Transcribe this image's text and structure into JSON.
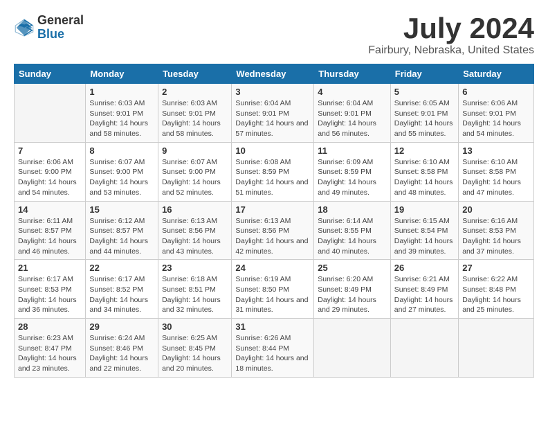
{
  "logo": {
    "general": "General",
    "blue": "Blue"
  },
  "title": "July 2024",
  "subtitle": "Fairbury, Nebraska, United States",
  "days": [
    "Sunday",
    "Monday",
    "Tuesday",
    "Wednesday",
    "Thursday",
    "Friday",
    "Saturday"
  ],
  "weeks": [
    [
      {
        "date": "",
        "sunrise": "",
        "sunset": "",
        "daylight": ""
      },
      {
        "date": "1",
        "sunrise": "Sunrise: 6:03 AM",
        "sunset": "Sunset: 9:01 PM",
        "daylight": "Daylight: 14 hours and 58 minutes."
      },
      {
        "date": "2",
        "sunrise": "Sunrise: 6:03 AM",
        "sunset": "Sunset: 9:01 PM",
        "daylight": "Daylight: 14 hours and 58 minutes."
      },
      {
        "date": "3",
        "sunrise": "Sunrise: 6:04 AM",
        "sunset": "Sunset: 9:01 PM",
        "daylight": "Daylight: 14 hours and 57 minutes."
      },
      {
        "date": "4",
        "sunrise": "Sunrise: 6:04 AM",
        "sunset": "Sunset: 9:01 PM",
        "daylight": "Daylight: 14 hours and 56 minutes."
      },
      {
        "date": "5",
        "sunrise": "Sunrise: 6:05 AM",
        "sunset": "Sunset: 9:01 PM",
        "daylight": "Daylight: 14 hours and 55 minutes."
      },
      {
        "date": "6",
        "sunrise": "Sunrise: 6:06 AM",
        "sunset": "Sunset: 9:01 PM",
        "daylight": "Daylight: 14 hours and 54 minutes."
      }
    ],
    [
      {
        "date": "7",
        "sunrise": "Sunrise: 6:06 AM",
        "sunset": "Sunset: 9:00 PM",
        "daylight": "Daylight: 14 hours and 54 minutes."
      },
      {
        "date": "8",
        "sunrise": "Sunrise: 6:07 AM",
        "sunset": "Sunset: 9:00 PM",
        "daylight": "Daylight: 14 hours and 53 minutes."
      },
      {
        "date": "9",
        "sunrise": "Sunrise: 6:07 AM",
        "sunset": "Sunset: 9:00 PM",
        "daylight": "Daylight: 14 hours and 52 minutes."
      },
      {
        "date": "10",
        "sunrise": "Sunrise: 6:08 AM",
        "sunset": "Sunset: 8:59 PM",
        "daylight": "Daylight: 14 hours and 51 minutes."
      },
      {
        "date": "11",
        "sunrise": "Sunrise: 6:09 AM",
        "sunset": "Sunset: 8:59 PM",
        "daylight": "Daylight: 14 hours and 49 minutes."
      },
      {
        "date": "12",
        "sunrise": "Sunrise: 6:10 AM",
        "sunset": "Sunset: 8:58 PM",
        "daylight": "Daylight: 14 hours and 48 minutes."
      },
      {
        "date": "13",
        "sunrise": "Sunrise: 6:10 AM",
        "sunset": "Sunset: 8:58 PM",
        "daylight": "Daylight: 14 hours and 47 minutes."
      }
    ],
    [
      {
        "date": "14",
        "sunrise": "Sunrise: 6:11 AM",
        "sunset": "Sunset: 8:57 PM",
        "daylight": "Daylight: 14 hours and 46 minutes."
      },
      {
        "date": "15",
        "sunrise": "Sunrise: 6:12 AM",
        "sunset": "Sunset: 8:57 PM",
        "daylight": "Daylight: 14 hours and 44 minutes."
      },
      {
        "date": "16",
        "sunrise": "Sunrise: 6:13 AM",
        "sunset": "Sunset: 8:56 PM",
        "daylight": "Daylight: 14 hours and 43 minutes."
      },
      {
        "date": "17",
        "sunrise": "Sunrise: 6:13 AM",
        "sunset": "Sunset: 8:56 PM",
        "daylight": "Daylight: 14 hours and 42 minutes."
      },
      {
        "date": "18",
        "sunrise": "Sunrise: 6:14 AM",
        "sunset": "Sunset: 8:55 PM",
        "daylight": "Daylight: 14 hours and 40 minutes."
      },
      {
        "date": "19",
        "sunrise": "Sunrise: 6:15 AM",
        "sunset": "Sunset: 8:54 PM",
        "daylight": "Daylight: 14 hours and 39 minutes."
      },
      {
        "date": "20",
        "sunrise": "Sunrise: 6:16 AM",
        "sunset": "Sunset: 8:53 PM",
        "daylight": "Daylight: 14 hours and 37 minutes."
      }
    ],
    [
      {
        "date": "21",
        "sunrise": "Sunrise: 6:17 AM",
        "sunset": "Sunset: 8:53 PM",
        "daylight": "Daylight: 14 hours and 36 minutes."
      },
      {
        "date": "22",
        "sunrise": "Sunrise: 6:17 AM",
        "sunset": "Sunset: 8:52 PM",
        "daylight": "Daylight: 14 hours and 34 minutes."
      },
      {
        "date": "23",
        "sunrise": "Sunrise: 6:18 AM",
        "sunset": "Sunset: 8:51 PM",
        "daylight": "Daylight: 14 hours and 32 minutes."
      },
      {
        "date": "24",
        "sunrise": "Sunrise: 6:19 AM",
        "sunset": "Sunset: 8:50 PM",
        "daylight": "Daylight: 14 hours and 31 minutes."
      },
      {
        "date": "25",
        "sunrise": "Sunrise: 6:20 AM",
        "sunset": "Sunset: 8:49 PM",
        "daylight": "Daylight: 14 hours and 29 minutes."
      },
      {
        "date": "26",
        "sunrise": "Sunrise: 6:21 AM",
        "sunset": "Sunset: 8:49 PM",
        "daylight": "Daylight: 14 hours and 27 minutes."
      },
      {
        "date": "27",
        "sunrise": "Sunrise: 6:22 AM",
        "sunset": "Sunset: 8:48 PM",
        "daylight": "Daylight: 14 hours and 25 minutes."
      }
    ],
    [
      {
        "date": "28",
        "sunrise": "Sunrise: 6:23 AM",
        "sunset": "Sunset: 8:47 PM",
        "daylight": "Daylight: 14 hours and 23 minutes."
      },
      {
        "date": "29",
        "sunrise": "Sunrise: 6:24 AM",
        "sunset": "Sunset: 8:46 PM",
        "daylight": "Daylight: 14 hours and 22 minutes."
      },
      {
        "date": "30",
        "sunrise": "Sunrise: 6:25 AM",
        "sunset": "Sunset: 8:45 PM",
        "daylight": "Daylight: 14 hours and 20 minutes."
      },
      {
        "date": "31",
        "sunrise": "Sunrise: 6:26 AM",
        "sunset": "Sunset: 8:44 PM",
        "daylight": "Daylight: 14 hours and 18 minutes."
      },
      {
        "date": "",
        "sunrise": "",
        "sunset": "",
        "daylight": ""
      },
      {
        "date": "",
        "sunrise": "",
        "sunset": "",
        "daylight": ""
      },
      {
        "date": "",
        "sunrise": "",
        "sunset": "",
        "daylight": ""
      }
    ]
  ]
}
